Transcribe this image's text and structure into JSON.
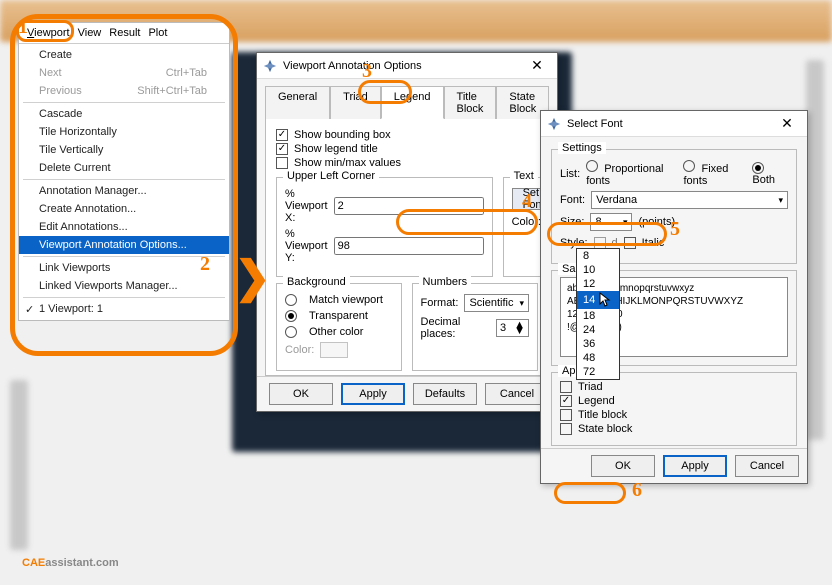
{
  "annots": {
    "n1": "1",
    "n2": "2",
    "n3": "3",
    "n4": "4",
    "n5": "5",
    "n6": "6"
  },
  "arrow": "❯",
  "watermark": {
    "a": "CAE",
    "b": "assistant.com"
  },
  "menubar": {
    "viewport": "Viewport",
    "view": "View",
    "result": "Result",
    "plot": "Plot"
  },
  "menu": {
    "create": "Create",
    "next": "Next",
    "next_hot": "Ctrl+Tab",
    "previous": "Previous",
    "previous_hot": "Shift+Ctrl+Tab",
    "cascade": "Cascade",
    "tile_h": "Tile Horizontally",
    "tile_v": "Tile Vertically",
    "delete": "Delete Current",
    "ann_mgr": "Annotation Manager...",
    "create_ann": "Create Annotation...",
    "edit_ann": "Edit Annotations...",
    "vp_ann_opt": "Viewport Annotation Options...",
    "link_vp": "Link Viewports",
    "linked_mgr": "Linked Viewports Manager...",
    "vp1_mark": "✓",
    "vp1": "1 Viewport: 1"
  },
  "dlg1": {
    "title": "Viewport Annotation Options",
    "tabs": {
      "general": "General",
      "triad": "Triad",
      "legend": "Legend",
      "title_block": "Title Block",
      "state_block": "State Block"
    },
    "show_bbox": "Show bounding box",
    "show_legend_title": "Show legend title",
    "show_minmax": "Show min/max values",
    "ulc": "Upper Left Corner",
    "pvx": "% Viewport X:",
    "pvx_val": "2",
    "pvy": "% Viewport Y:",
    "pvy_val": "98",
    "text": "Text",
    "set_font": "Set Font...",
    "color": "Color:",
    "background": "Background",
    "match_vp": "Match viewport",
    "transparent": "Transparent",
    "other_color": "Other color",
    "bgcolor": "Color:",
    "numbers": "Numbers",
    "format": "Format:",
    "format_val": "Scientific",
    "decimal": "Decimal places:",
    "decimal_val": "3",
    "ok": "OK",
    "apply": "Apply",
    "defaults": "Defaults",
    "cancel": "Cancel"
  },
  "dlg2": {
    "title": "Select Font",
    "settings": "Settings",
    "list": "List:",
    "prop": "Proportional fonts",
    "fixed": "Fixed fonts",
    "both": "Both",
    "font": "Font:",
    "font_val": "Verdana",
    "size": "Size:",
    "size_val": "8",
    "points": "(points)",
    "size_options": [
      "8",
      "10",
      "12",
      "14",
      "18",
      "24",
      "36",
      "48",
      "72"
    ],
    "size_highlight": "14",
    "style": "Style:",
    "bold_chk": "d",
    "bold": "Bold",
    "italic": "Italic",
    "sample": "Sample",
    "sample_text": "abcdefghijklmnopqrstuvwxyz\nABCDEFGHIJKLMONPQRSTUVWXYZ\n1234567890\n!@#$%^&*()",
    "apply_to": "Apply To",
    "triad": "Triad",
    "legend": "Legend",
    "title_block": "Title block",
    "state_block": "State block",
    "ok": "OK",
    "apply": "Apply",
    "cancel": "Cancel"
  }
}
